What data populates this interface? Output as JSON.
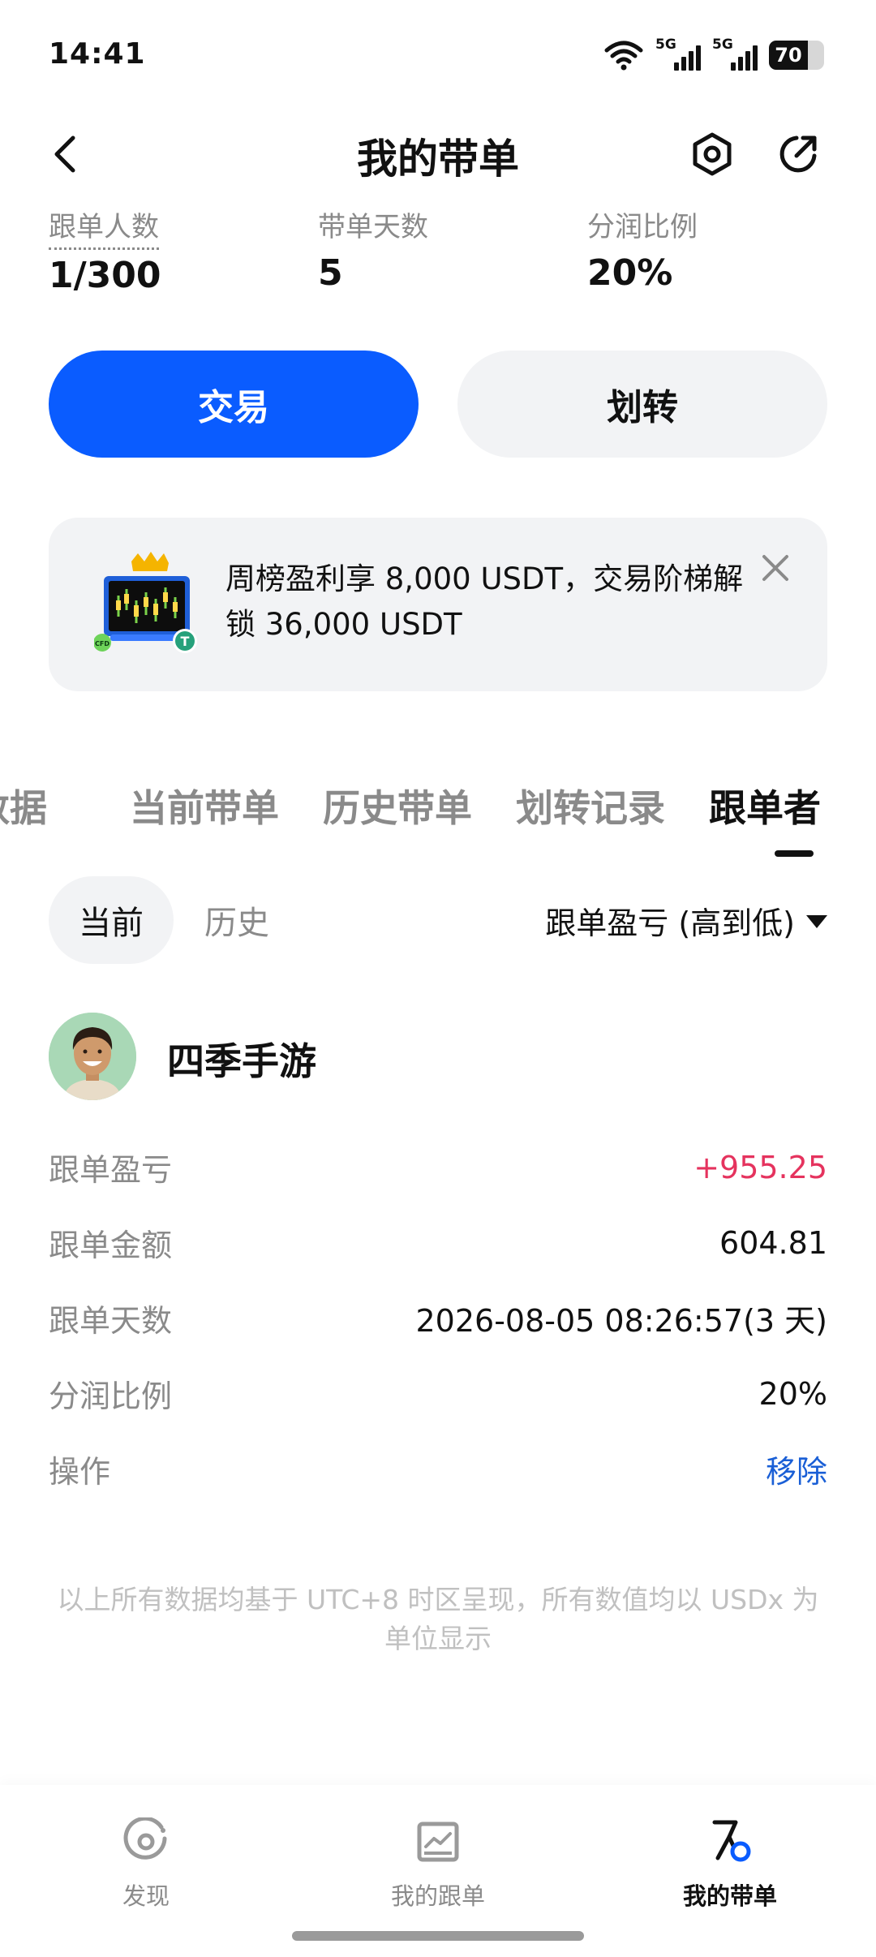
{
  "status_bar": {
    "time": "14:41",
    "network_1": "5G",
    "network_2": "5G",
    "battery": "70",
    "battery_level": 0.7,
    "icons": [
      "wifi-icon",
      "signal-icon",
      "signal-icon",
      "battery-icon"
    ]
  },
  "header": {
    "title": "我的带单",
    "icons": [
      "back-arrow-icon",
      "settings-hexagon-icon",
      "share-icon"
    ]
  },
  "stats": [
    {
      "label": "跟单人数",
      "value": "1/300"
    },
    {
      "label": "带单天数",
      "value": "5"
    },
    {
      "label": "分润比例",
      "value": "20%"
    }
  ],
  "actions": {
    "primary_label": "交易",
    "secondary_label": "划转",
    "primary_color": "#0A5CFF"
  },
  "banner": {
    "text": "周榜盈利享 8,000 USDT，交易阶梯解锁 36,000 USDT",
    "image_badges": [
      "CFD",
      "T"
    ],
    "icons": [
      "trading-trophy-icon",
      "close-icon"
    ]
  },
  "tabs": [
    {
      "label": "数据",
      "active": false
    },
    {
      "label": "当前带单",
      "active": false
    },
    {
      "label": "历史带单",
      "active": false
    },
    {
      "label": "划转记录",
      "active": false
    },
    {
      "label": "跟单者",
      "active": true
    }
  ],
  "filter": {
    "segments": [
      {
        "label": "当前",
        "active": true
      },
      {
        "label": "历史",
        "active": false
      }
    ],
    "sort_label": "跟单盈亏 (高到低)",
    "sort_icon": "caret-down-icon"
  },
  "follower": {
    "name": "四季手游",
    "rows": [
      {
        "label": "跟单盈亏",
        "value": "+955.25"
      },
      {
        "label": "跟单金额",
        "value": "604.81"
      },
      {
        "label": "跟单天数",
        "value": "2026-08-05 08:26:57(3 天)"
      },
      {
        "label": "分润比例",
        "value": "20%"
      },
      {
        "label": "操作",
        "value": "移除"
      }
    ],
    "positive_color": "#E5335E",
    "link_color": "#1A5FD6"
  },
  "footnote": "以上所有数据均基于 UTC+8 时区呈现，所有数值均以 USDx 为单位显示",
  "bottom_nav": [
    {
      "label": "发现",
      "icon": "discover-icon",
      "active": false
    },
    {
      "label": "我的跟单",
      "icon": "chart-box-icon",
      "active": false
    },
    {
      "label": "我的带单",
      "icon": "lead-trader-icon",
      "active": true
    }
  ]
}
